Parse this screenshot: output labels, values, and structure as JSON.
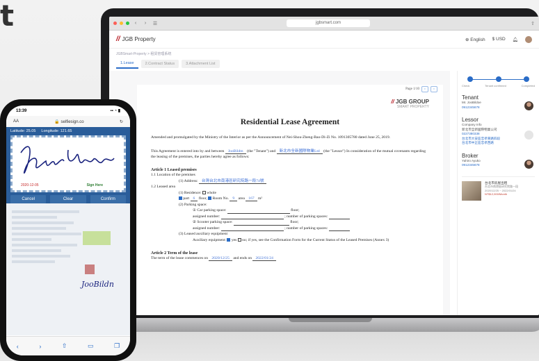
{
  "hero": {
    "text": "t"
  },
  "browser": {
    "url": "jgbsmart.com",
    "nav_back": "‹",
    "nav_forward": "›",
    "reader": "☰",
    "share": "⇧"
  },
  "app": {
    "brand": "JGB Property",
    "language": "English",
    "currency": "$ USD",
    "breadcrumb": "JGBSmart-Property > 租赁管理系统",
    "tabs": [
      {
        "label": "1.Lease"
      },
      {
        "label": "2.Contract Status"
      },
      {
        "label": "3.Attachment List"
      }
    ],
    "pager": "Page 1/10"
  },
  "document": {
    "company": "JGB GROUP",
    "company_sub": "SMART PROPERTY",
    "title": "Residential Lease Agreement",
    "intro": "Amended and promulgated by the Ministry of the Interior as per the Announcement of Nei-Shou-Zheng-Bao-Di-Zi No. 1091305780 dated June 25, 2019.",
    "agreement_a": "This Agreement is entered into by and between",
    "tenant_name": "JooBildm",
    "tenant_role": "(the \"Tenant\") and",
    "lessor_name": "新北市全新國際物業Ltd",
    "agreement_b": "(the \"Lessor\") In consideration of the mutual covenants regarding the leasing of the premises, the parties hereby agree as follows:",
    "article1_title": "Article 1 Leased premises",
    "a1_1": "1.1 Location of the premises",
    "address_label": "(1) Address:",
    "address_value": "台灣台北市南港區研究院路一段74號",
    "a1_2": "1.2 Leased area",
    "residence_label": "(1) Residence:",
    "whole_label": "whole",
    "part_label": "part",
    "floor_value": "6",
    "floor_label": "floor,",
    "room_label": "Room No.",
    "room_value": "9",
    "area_label": "area",
    "area_value": "167",
    "area_unit": "m²",
    "parking_label": "(2) Parking space:",
    "car_label": "① Car parking space:",
    "floor_suffix": "floor;",
    "assigned_label": "assigned number:",
    "num_spaces_label": "; number of parking spaces:",
    "scooter_label": "② Scooter parking space:",
    "equip_label": "(3) Leased auxiliary equipment",
    "aux_label": "Auxiliary equipment:",
    "yes_label": "yes",
    "no_label": "no;",
    "aux_note": "if yes, see the Confirmation Form for the Current Status of the Leased Premises (Annex 3)",
    "article2_title": "Article 2 Term of the lease",
    "term_a": "The term of the lease commences on",
    "start_date": "2020/12/25",
    "term_b": "and ends on",
    "end_date": "2022/01/24"
  },
  "sidebar": {
    "steps": [
      "Check",
      "Tenant confirmed",
      "Completed"
    ],
    "tenant_title": "Tenant",
    "tenant_name": "Mr. JooBildoe",
    "tenant_phone": "0912345678",
    "lessor_title": "Lessor",
    "lessor_lines": [
      "Company Info",
      "新北市全新國際物業公司",
      "0227380338",
      "台北市大安區忠孝東路四段",
      "台北市中正區忠孝西路"
    ],
    "broker_title": "Broker",
    "broker_name": "Yahiro Ayuko",
    "broker_phone": "0912345678",
    "card_title": "台北市房屋出租",
    "card_lines": [
      "台北市南港區研究院路一段",
      "2020/12/25 ~ 2022/01/24"
    ],
    "card_price": "NT$12,000/Month"
  },
  "phone": {
    "time": "13:39",
    "status_right": "▪▪ ◔ ▮",
    "aA": "AA",
    "site": "🔒 selfiesign.co",
    "reload": "↻",
    "lat": "Latitude: 25.05",
    "lng": "Longitude: 121.65",
    "signature": "Yahiro Ayuko",
    "sig_date": "2020-12-05",
    "sign_here": "Sign Here",
    "buttons": [
      "Cancel",
      "Clear",
      "Confirm"
    ],
    "mini_signature": "JooBildn",
    "toolbar": [
      "‹",
      "›",
      "⇧",
      "▭",
      "❐"
    ]
  }
}
